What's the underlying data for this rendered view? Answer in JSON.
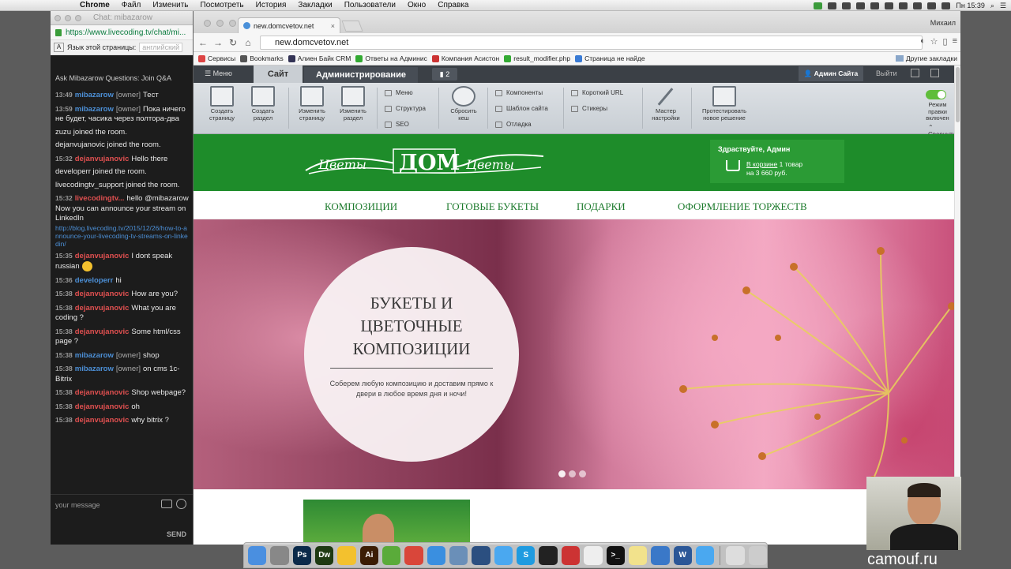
{
  "menubar": {
    "app": "Chrome",
    "items": [
      "Файл",
      "Изменить",
      "Посмотреть",
      "История",
      "Закладки",
      "Пользователи",
      "Окно",
      "Справка"
    ],
    "clock": "Пн 15:39"
  },
  "chat_window": {
    "title": "Chat: mibazarow",
    "url": "https://www.livecoding.tv/chat/mi...",
    "translate_prompt": "Язык этой страницы:",
    "translate_lang": "английский",
    "header": "Ask Mibazarow Questions: Join Q&A",
    "messages": [
      {
        "time": "13:49",
        "user": "mibazarow",
        "user_color": "blue",
        "role": "[owner]",
        "text": "Тест"
      },
      {
        "time": "13:59",
        "user": "mibazarow",
        "user_color": "blue",
        "role": "[owner]",
        "text": "Пока ничего не будет, часика через полтора-два"
      },
      {
        "time": "",
        "user": "",
        "user_color": "",
        "role": "",
        "text": "zuzu joined the room."
      },
      {
        "time": "",
        "user": "",
        "user_color": "",
        "role": "",
        "text": "dejanvujanovic joined the room."
      },
      {
        "time": "15:32",
        "user": "dejanvujanovic",
        "user_color": "red",
        "role": "",
        "text": "Hello there"
      },
      {
        "time": "",
        "user": "",
        "user_color": "",
        "role": "",
        "text": "developerr joined the room."
      },
      {
        "time": "",
        "user": "",
        "user_color": "",
        "role": "",
        "text": "livecodingtv_support joined the room."
      },
      {
        "time": "15:32",
        "user": "livecodingtv...",
        "user_color": "red",
        "role": "",
        "text": "hello @mibazarow Now you can announce your stream on LinkedIn",
        "link": "http://blog.livecoding.tv/2015/12/26/how-to-announce-your-livecoding-tv-streams-on-linkedin/"
      },
      {
        "time": "15:35",
        "user": "dejanvujanovic",
        "user_color": "red",
        "role": "",
        "text": "I dont speak russian",
        "emoji": true
      },
      {
        "time": "15:36",
        "user": "developerr",
        "user_color": "blue",
        "role": "",
        "text": "hi"
      },
      {
        "time": "15:38",
        "user": "dejanvujanovic",
        "user_color": "red",
        "role": "",
        "text": "How are you?"
      },
      {
        "time": "15:38",
        "user": "dejanvujanovic",
        "user_color": "red",
        "role": "",
        "text": "What you are coding ?"
      },
      {
        "time": "15:38",
        "user": "dejanvujanovic",
        "user_color": "red",
        "role": "",
        "text": "Some html/css page ?"
      },
      {
        "time": "15:38",
        "user": "mibazarow",
        "user_color": "blue",
        "role": "[owner]",
        "text": "shop"
      },
      {
        "time": "15:38",
        "user": "mibazarow",
        "user_color": "blue",
        "role": "[owner]",
        "text": "on cms 1c-Bitrix"
      },
      {
        "time": "15:38",
        "user": "dejanvujanovic",
        "user_color": "red",
        "role": "",
        "text": "Shop webpage?"
      },
      {
        "time": "15:38",
        "user": "dejanvujanovic",
        "user_color": "red",
        "role": "",
        "text": "oh"
      },
      {
        "time": "15:38",
        "user": "dejanvujanovic",
        "user_color": "red",
        "role": "",
        "text": "why bitrix ?"
      }
    ],
    "input_placeholder": "your message",
    "send_label": "SEND"
  },
  "browser": {
    "tab_title": "new.domcvetov.net",
    "profile": "Михаил",
    "url": "new.domcvetov.net",
    "bookmarks": [
      {
        "label": "Сервисы",
        "color": "#d44"
      },
      {
        "label": "Bookmarks",
        "color": "#555"
      },
      {
        "label": "Алиен Байк CRM",
        "color": "#335"
      },
      {
        "label": "Ответы на Админис",
        "color": "#3a3"
      },
      {
        "label": "Компания Асистон",
        "color": "#c33"
      },
      {
        "label": "result_modifier.php",
        "color": "#3a3"
      },
      {
        "label": "Страница не найде",
        "color": "#3a7bd5"
      }
    ],
    "other_bookmarks": "Другие закладки"
  },
  "admin": {
    "menu_label": "Меню",
    "tab_site": "Сайт",
    "tab_admin": "Администрирование",
    "notifications": "2",
    "user": "Админ Сайта",
    "logout": "Выйти",
    "buttons": [
      {
        "label": "Создать страницу"
      },
      {
        "label": "Создать раздел"
      },
      {
        "label": "Изменить страницу"
      },
      {
        "label": "Изменить раздел"
      },
      {
        "label": "Сбросить кеш"
      },
      {
        "label": "Мастер настройки"
      },
      {
        "label": "Протестировать новое решение"
      }
    ],
    "links_col1": [
      "Меню",
      "Структура",
      "SEO"
    ],
    "links_col2": [
      "Компоненты",
      "Шаблон сайта",
      "Отладка"
    ],
    "links_col3": [
      "Короткий URL",
      "Стикеры"
    ],
    "edit_mode": "Режим правки включен",
    "collapse": "Свернуть"
  },
  "site": {
    "greeting": "Здраствуйте, Админ",
    "cart_link": "В корзине",
    "cart_count": "1 товар",
    "cart_sum": "на 3 660 руб.",
    "nav": [
      "КОМПОЗИЦИИ",
      "ГОТОВЫЕ БУКЕТЫ",
      "ПОДАРКИ",
      "ОФОРМЛЕНИЕ ТОРЖЕСТВ"
    ],
    "hero_title_1": "БУКЕТЫ И",
    "hero_title_2": "ЦВЕТОЧНЫЕ",
    "hero_title_3": "КОМПОЗИЦИИ",
    "hero_subtitle": "Соберем любую композицию и доставим прямо к двери в любое время дня и ночи!",
    "slides_total": 3,
    "slide_active": 1
  },
  "overlay": {
    "brand": "camouf.ru"
  },
  "dock": [
    {
      "name": "finder-icon",
      "color": "#4a8fe0",
      "glyph": ""
    },
    {
      "name": "launchpad-icon",
      "color": "#888",
      "glyph": ""
    },
    {
      "name": "photoshop-icon",
      "color": "#0b2a4a",
      "glyph": "Ps"
    },
    {
      "name": "dreamweaver-icon",
      "color": "#1e3a12",
      "glyph": "Dw"
    },
    {
      "name": "emoji-app-icon",
      "color": "#f3c12e",
      "glyph": ""
    },
    {
      "name": "illustrator-icon",
      "color": "#3b1d04",
      "glyph": "Ai"
    },
    {
      "name": "leaf-app-icon",
      "color": "#5aab3a",
      "glyph": ""
    },
    {
      "name": "chrome-icon",
      "color": "#d9463a",
      "glyph": ""
    },
    {
      "name": "safari-icon",
      "color": "#3a8fe0",
      "glyph": ""
    },
    {
      "name": "preview-icon",
      "color": "#6a8fb8",
      "glyph": ""
    },
    {
      "name": "quicktime-icon",
      "color": "#2b4f80",
      "glyph": ""
    },
    {
      "name": "messages-icon",
      "color": "#4aa8f0",
      "glyph": ""
    },
    {
      "name": "skype-icon",
      "color": "#1f9be0",
      "glyph": "S"
    },
    {
      "name": "obs-icon",
      "color": "#222",
      "glyph": ""
    },
    {
      "name": "colorsync-icon",
      "color": "#c33",
      "glyph": ""
    },
    {
      "name": "calendar-icon",
      "color": "#eee",
      "glyph": ""
    },
    {
      "name": "terminal-icon",
      "color": "#111",
      "glyph": ">_"
    },
    {
      "name": "notes-icon",
      "color": "#f2e28c",
      "glyph": ""
    },
    {
      "name": "sphere-icon",
      "color": "#3a78c8",
      "glyph": ""
    },
    {
      "name": "word-icon",
      "color": "#2b5797",
      "glyph": "W"
    },
    {
      "name": "cloud-app-icon",
      "color": "#4aa8f0",
      "glyph": ""
    },
    {
      "name": "keyboard-icon",
      "color": "#ddd",
      "glyph": ""
    },
    {
      "name": "trash-icon",
      "color": "#ccc",
      "glyph": ""
    }
  ]
}
